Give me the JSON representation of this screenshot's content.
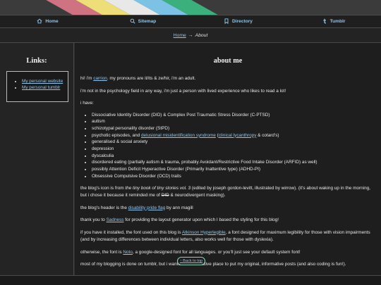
{
  "nav": {
    "items": [
      {
        "label": "Home",
        "icon": "home-icon"
      },
      {
        "label": "Sitemap",
        "icon": "search-icon"
      },
      {
        "label": "Directory",
        "icon": "bookmark-icon"
      },
      {
        "label": "Tumblr",
        "icon": "tumblr-icon"
      }
    ],
    "color": "#8fc5ea"
  },
  "breadcrumb": {
    "home": "Home",
    "separator": "→",
    "current": "About"
  },
  "sidebar": {
    "title": "Links:",
    "links": [
      "My personal website",
      "My personal tumblr"
    ]
  },
  "main": {
    "title": "about me",
    "intro": {
      "pre": "hi! i'm ",
      "link": "carrion",
      "post": ". my pronouns are it/its & ze/hir, i'm an adult."
    },
    "p_field": "i'm not in the psychology field in any way, i'm just a person with lived experience who likes to read a lot!",
    "p_have": "i have:",
    "conditions": {
      "did": "Dissociative Identity Disorder (DID) & Complex Post Traumatic Stress Disorder (C-PTSD)",
      "autism": "autism",
      "stpd": "schizotypal personality disorder (StPD)",
      "psych_pre": "psychotic episodes, and ",
      "psych_link1": "delusional misidentification syndrome",
      "psych_mid": " (",
      "psych_link2": "clinical lycanthropy",
      "psych_post": " & cotard's)",
      "anxiety": "generalised & social anxiety",
      "depression": "depression",
      "dyscalculia": "dyscalculia",
      "arfid": "disordered eating (partially autism & trauma, probably Avoidant/Restrictive Food Intake Disorder (ARFID) as well)",
      "adhd": "possibly Attention Deficit Hyperactive Disorder (Primarily Inattentive type) (ADHD-PI)",
      "ocd": "Obsessive Compulsive Disorder (OCD) traits"
    },
    "icon_p": {
      "pre": "the blog's icon is from ",
      "book": "the tiny book of tiny stories vol. 3",
      "post": " (edited by joseph gordon-levitt, illustrated by wirrow). (it's about waking up in the morning, but i chose it because it reminded me of ",
      "strike": "DID",
      "end": " & neurodivergent masking)."
    },
    "header_p": {
      "pre": "the blog's header is the ",
      "link": "disability pride flag",
      "post": " by ann magill"
    },
    "thanks_p": {
      "pre": "thank you to ",
      "link": "Sadness",
      "post": " for providing the layout generator upon which I based the styling for this blog!"
    },
    "font_p": {
      "pre": "if you have it installed, the font used on this blog is ",
      "link": "Atkinson Hyperlegible",
      "post": ", a font designed for maximum legibility for those with vision impairments (and by increasing differences between individual letters, also works well for those with dyslexia)."
    },
    "noto_p": {
      "pre": "otherwise, the font is ",
      "link": "Noto",
      "post": ", a google-designed font for all languages. or you'll just see your default system font!"
    },
    "tumblr_p": "most of my blogging is done on tumblr, but i wanted an alternative place to put my original, informative posts (and also coding is fun!)."
  },
  "back_to_top": "↑ Back to top"
}
